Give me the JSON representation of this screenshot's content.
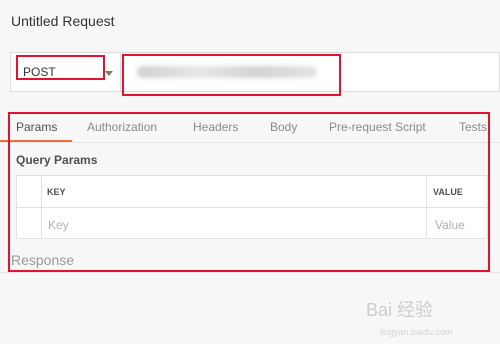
{
  "window": {
    "title": "Untitled Request"
  },
  "request": {
    "method": "POST",
    "url_value": ""
  },
  "tabs": [
    {
      "label": "Params",
      "active": true
    },
    {
      "label": "Authorization",
      "active": false
    },
    {
      "label": "Headers",
      "active": false
    },
    {
      "label": "Body",
      "active": false
    },
    {
      "label": "Pre-request Script",
      "active": false
    },
    {
      "label": "Tests",
      "active": false
    }
  ],
  "params": {
    "section_title": "Query Params",
    "headers": [
      "KEY",
      "VALUE"
    ],
    "placeholders": [
      "Key",
      "Value"
    ]
  },
  "response": {
    "label": "Response"
  },
  "colors": {
    "accent": "#f26b3a",
    "highlight_red": "#e3122e"
  },
  "watermark": {
    "text": "Bai 经验",
    "sub": "jingyan.baidu.com"
  }
}
